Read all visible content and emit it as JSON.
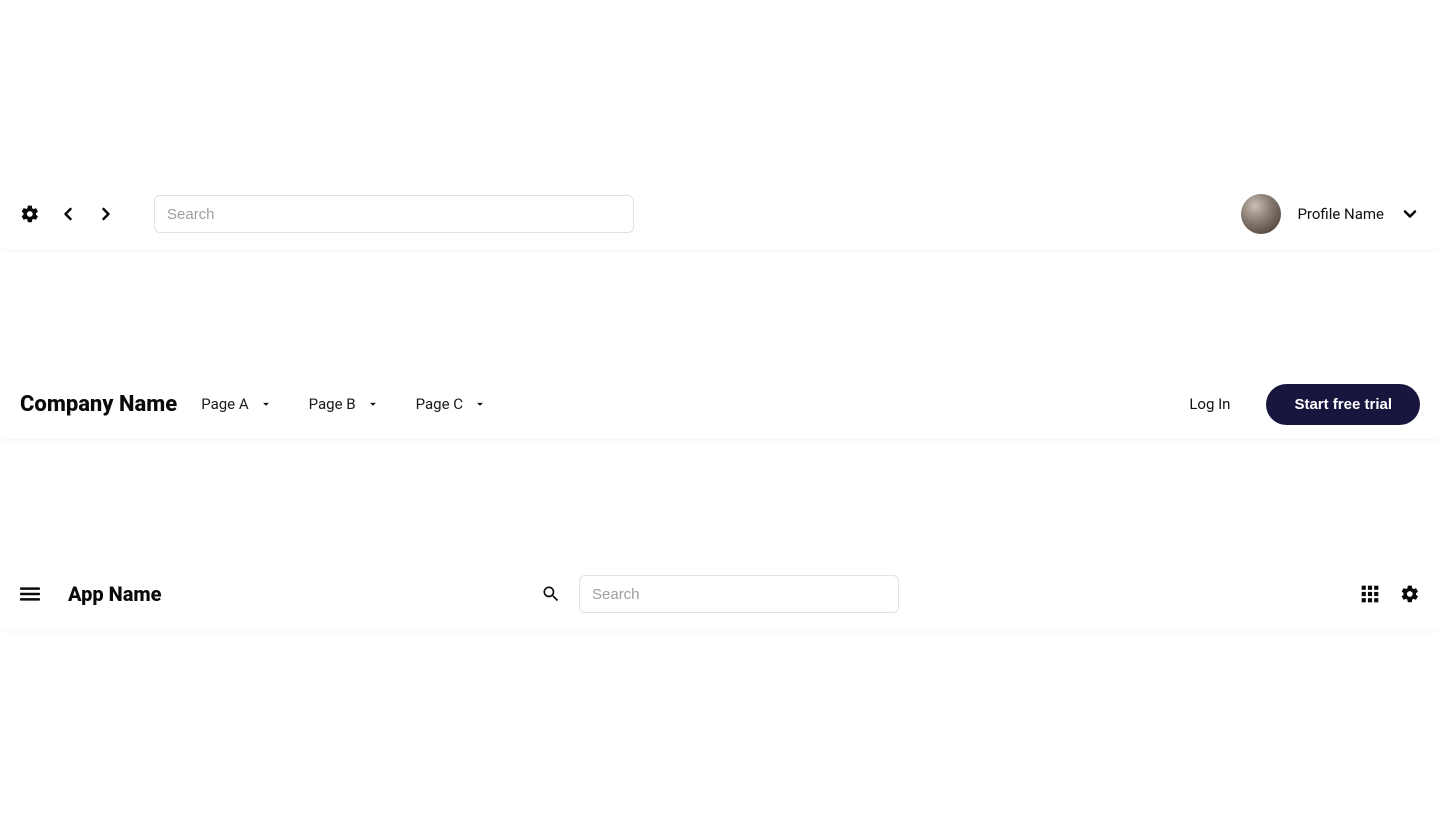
{
  "navbar1": {
    "search_placeholder": "Search",
    "profile_name": "Profile Name"
  },
  "navbar2": {
    "brand": "Company Name",
    "links": [
      "Page A",
      "Page B",
      "Page C"
    ],
    "login_label": "Log In",
    "cta_label": "Start free trial"
  },
  "navbar3": {
    "app_name": "App Name",
    "search_placeholder": "Search"
  },
  "colors": {
    "cta_bg": "#18163e",
    "text": "#0a0a0a",
    "border": "#e1e1e1"
  }
}
